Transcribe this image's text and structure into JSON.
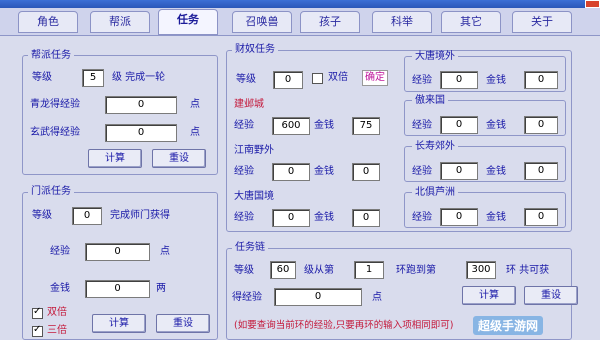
{
  "tabs": [
    "角色",
    "帮派",
    "任务",
    "召唤兽",
    "孩子",
    "科举",
    "其它",
    "关于"
  ],
  "gang_task": {
    "title": "帮派任务",
    "level_label": "等级",
    "level_value": "5",
    "level_suffix": "级 完成一轮",
    "qinglong_label": "青龙得经验",
    "qinglong_value": "0",
    "qinglong_unit": "点",
    "xuanwu_label": "玄武得经验",
    "xuanwu_value": "0",
    "xuanwu_unit": "点",
    "calc": "计算",
    "reset": "重设"
  },
  "sect_task": {
    "title": "门派任务",
    "level_label": "等级",
    "level_value": "0",
    "level_suffix": "完成师门获得",
    "exp_label": "经验",
    "exp_value": "0",
    "exp_unit": "点",
    "money_label": "金钱",
    "money_value": "0",
    "money_unit": "两",
    "double_label": "双倍",
    "triple_label": "三倍",
    "calc": "计算",
    "reset": "重设"
  },
  "bandit_task": {
    "title": "财奴任务",
    "level_label": "等级",
    "level_value": "0",
    "double_label": "双倍",
    "confirm": "确定",
    "jianye": {
      "title": "建邺城",
      "exp_label": "经验",
      "exp_value": "600",
      "money_label": "金钱",
      "money_value": "75"
    },
    "jiangnan": {
      "title": "江南野外",
      "exp_label": "经验",
      "exp_value": "0",
      "money_label": "金钱",
      "money_value": "0"
    },
    "datang_guojing": {
      "title": "大唐国境",
      "exp_label": "经验",
      "exp_value": "0",
      "money_label": "金钱",
      "money_value": "0"
    },
    "datang_jingwai": {
      "title": "大唐境外",
      "exp_value": "0",
      "money_value": "0"
    },
    "aolai": {
      "title": "傲来国",
      "exp_value": "0",
      "money_value": "0"
    },
    "changshou": {
      "title": "长寿郊外",
      "exp_value": "0",
      "money_value": "0"
    },
    "beiju": {
      "title": "北俱芦洲",
      "exp_value": "0",
      "money_value": "0"
    }
  },
  "chain_task": {
    "title": "任务链",
    "level_label": "等级",
    "level_value": "60",
    "from_label": "级从第",
    "from_value": "1",
    "to_label": "环跑到第",
    "to_value": "300",
    "total_label": "环 共可获",
    "get_exp_label": "得经验",
    "get_exp_value": "0",
    "get_exp_unit": "点",
    "calc": "计算",
    "reset": "重设",
    "note": "(如要查询当前环的经验,只要再环的输入项相同即可)"
  },
  "watermark": "超级手游网"
}
